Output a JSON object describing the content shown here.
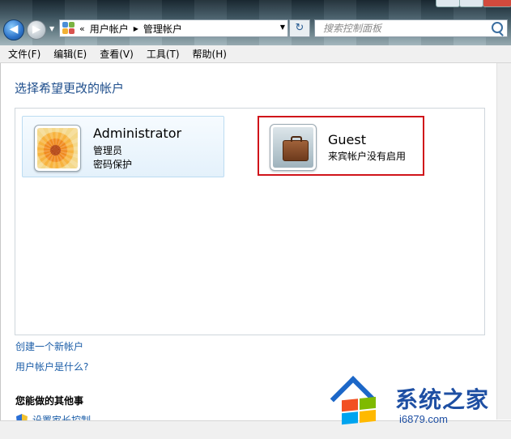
{
  "address_bar": {
    "overflow": "«",
    "crumbs": [
      "用户帐户",
      "管理帐户"
    ]
  },
  "search": {
    "placeholder": "搜索控制面板"
  },
  "menu": [
    "文件(F)",
    "编辑(E)",
    "查看(V)",
    "工具(T)",
    "帮助(H)"
  ],
  "main": {
    "heading": "选择希望更改的帐户",
    "accounts": [
      {
        "name": "Administrator",
        "lines": [
          "管理员",
          "密码保护"
        ],
        "highlighted": false
      },
      {
        "name": "Guest",
        "lines": [
          "来宾帐户没有启用"
        ],
        "highlighted": true
      }
    ],
    "links": [
      "创建一个新帐户",
      "用户帐户是什么?"
    ],
    "other_heading": "您能做的其他事",
    "other_items": [
      "设置家长控制"
    ]
  },
  "watermark": {
    "title": "系统之家",
    "url": "i6879.com"
  },
  "colors": {
    "link": "#1c5ea8",
    "heading": "#1e4e8c",
    "highlight_border": "#d0141a"
  }
}
